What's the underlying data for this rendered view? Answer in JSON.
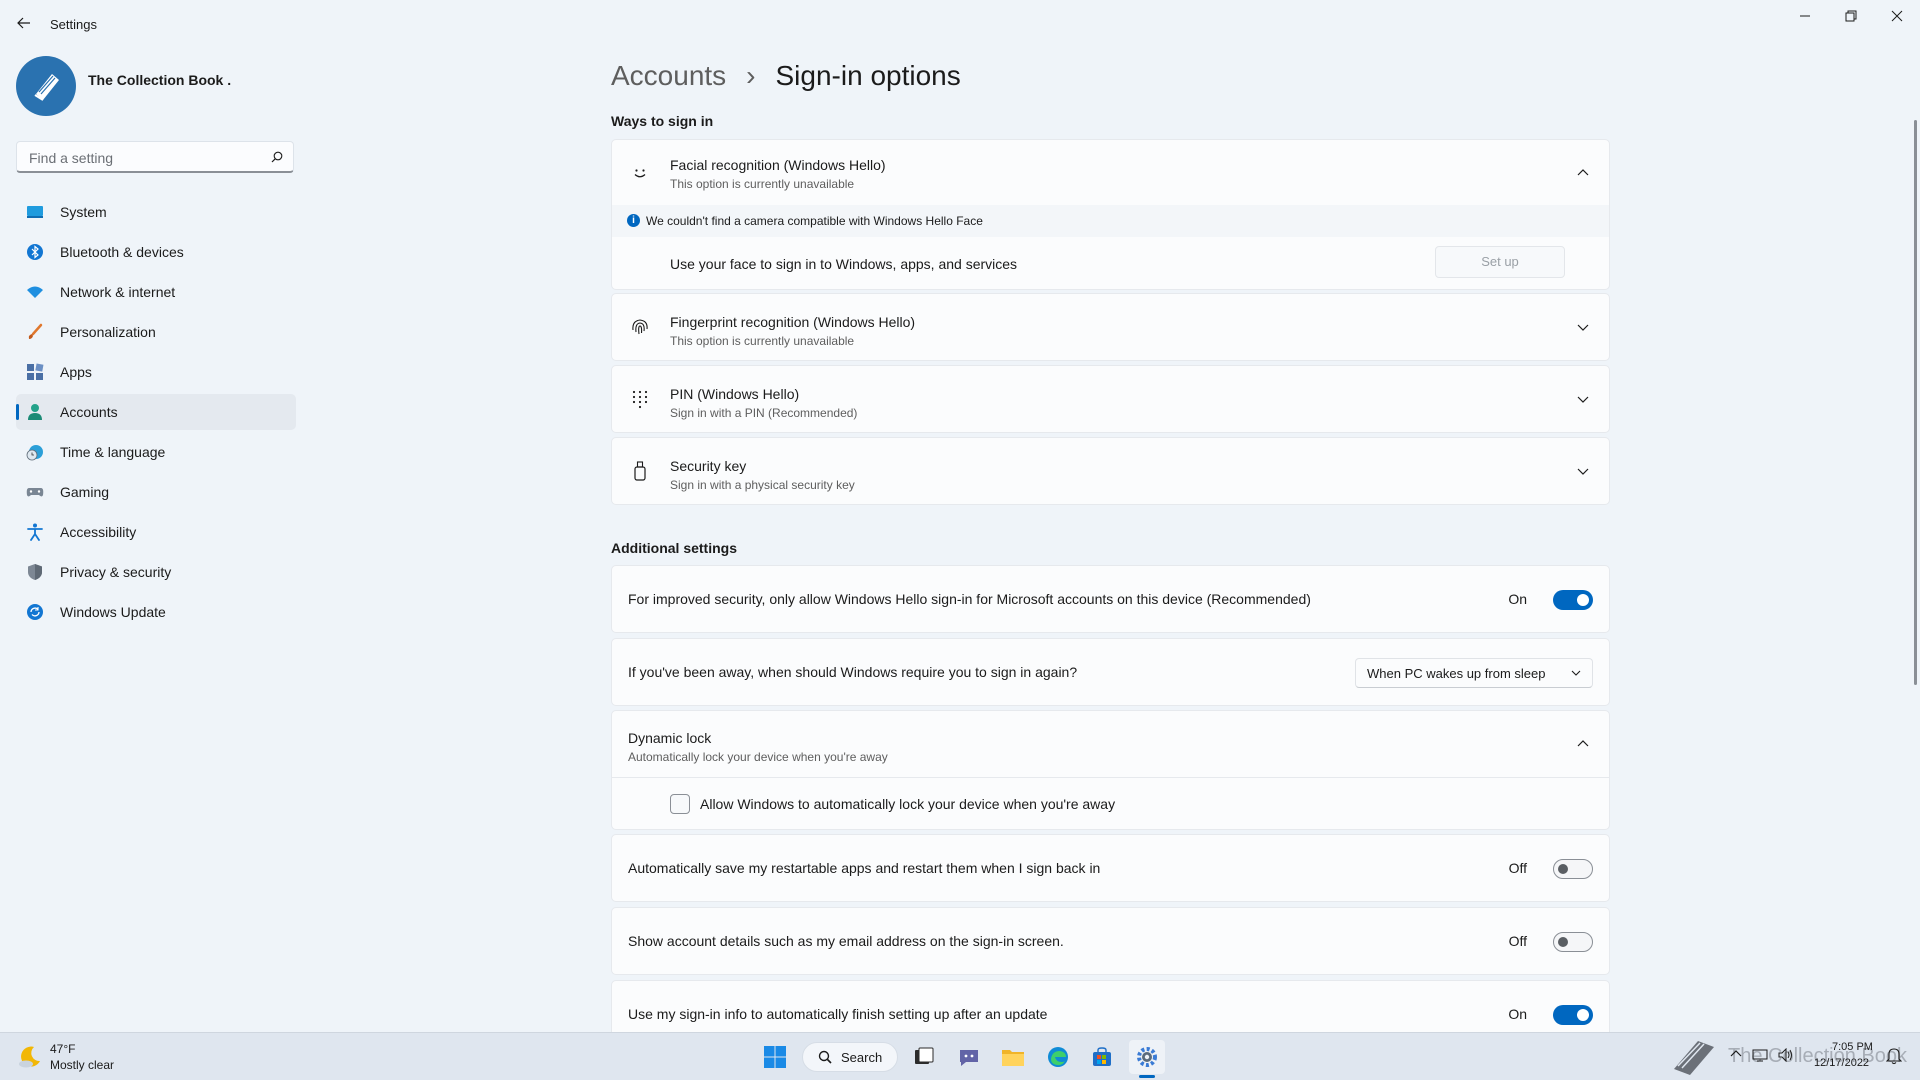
{
  "window": {
    "title": "Settings"
  },
  "profile": {
    "name": "The Collection Book ."
  },
  "search": {
    "placeholder": "Find a setting"
  },
  "sidebar": {
    "items": [
      {
        "label": "System",
        "icon": "system-icon"
      },
      {
        "label": "Bluetooth & devices",
        "icon": "bluetooth-icon"
      },
      {
        "label": "Network & internet",
        "icon": "wifi-icon"
      },
      {
        "label": "Personalization",
        "icon": "brush-icon"
      },
      {
        "label": "Apps",
        "icon": "apps-icon"
      },
      {
        "label": "Accounts",
        "icon": "accounts-icon",
        "active": true
      },
      {
        "label": "Time & language",
        "icon": "clock-globe-icon"
      },
      {
        "label": "Gaming",
        "icon": "gamepad-icon"
      },
      {
        "label": "Accessibility",
        "icon": "accessibility-icon"
      },
      {
        "label": "Privacy & security",
        "icon": "shield-icon"
      },
      {
        "label": "Windows Update",
        "icon": "update-icon"
      }
    ]
  },
  "breadcrumb": {
    "parent": "Accounts",
    "separator": "›",
    "current": "Sign-in options"
  },
  "ways": {
    "heading": "Ways to sign in",
    "face": {
      "title": "Facial recognition (Windows Hello)",
      "subtitle": "This option is currently unavailable",
      "info": "We couldn't find a camera compatible with Windows Hello Face",
      "setup_text": "Use your face to sign in to Windows, apps, and services",
      "setup_button": "Set up"
    },
    "fingerprint": {
      "title": "Fingerprint recognition (Windows Hello)",
      "subtitle": "This option is currently unavailable"
    },
    "pin": {
      "title": "PIN (Windows Hello)",
      "subtitle": "Sign in with a PIN (Recommended)"
    },
    "security_key": {
      "title": "Security key",
      "subtitle": "Sign in with a physical security key"
    }
  },
  "additional": {
    "heading": "Additional settings",
    "hello_only": {
      "text": "For improved security, only allow Windows Hello sign-in for Microsoft accounts on this device (Recommended)",
      "state_label": "On",
      "on": true
    },
    "require_signin": {
      "text": "If you've been away, when should Windows require you to sign in again?",
      "selected": "When PC wakes up from sleep"
    },
    "dynamic_lock": {
      "title": "Dynamic lock",
      "subtitle": "Automatically lock your device when you're away",
      "checkbox_label": "Allow Windows to automatically lock your device when you're away",
      "checked": false
    },
    "restart_apps": {
      "text": "Automatically save my restartable apps and restart them when I sign back in",
      "state_label": "Off",
      "on": false
    },
    "account_details": {
      "text": "Show account details such as my email address on the sign-in screen.",
      "state_label": "Off",
      "on": false
    },
    "finish_setup": {
      "text": "Use my sign-in info to automatically finish setting up after an update",
      "state_label": "On",
      "on": true
    }
  },
  "taskbar": {
    "weather_temp": "47°F",
    "weather_desc": "Mostly clear",
    "search_label": "Search",
    "watermark": "The Collection Book",
    "time": "7:05 PM",
    "date": "12/17/2022",
    "accent": "#0067c0"
  }
}
